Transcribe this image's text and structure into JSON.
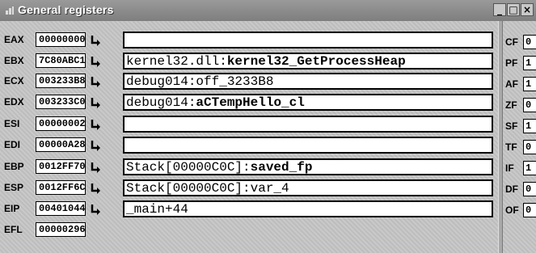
{
  "window": {
    "title": "General registers",
    "minimize_label": "_",
    "maximize_label": "□",
    "close_label": "×"
  },
  "registers": [
    {
      "name": "EAX",
      "value": "00000000",
      "ref": "",
      "ref_bold": ""
    },
    {
      "name": "EBX",
      "value": "7C80ABC1",
      "ref": "kernel32.dll:",
      "ref_bold": "kernel32_GetProcessHeap"
    },
    {
      "name": "ECX",
      "value": "003233B8",
      "ref": "debug014:off_3233B8",
      "ref_bold": ""
    },
    {
      "name": "EDX",
      "value": "003233C0",
      "ref": "debug014:",
      "ref_bold": "aCTempHello_cl"
    },
    {
      "name": "ESI",
      "value": "00000002",
      "ref": "",
      "ref_bold": ""
    },
    {
      "name": "EDI",
      "value": "00000A28",
      "ref": "",
      "ref_bold": ""
    },
    {
      "name": "EBP",
      "value": "0012FF70",
      "ref": "Stack[00000C0C]:",
      "ref_bold": "saved_fp"
    },
    {
      "name": "ESP",
      "value": "0012FF6C",
      "ref": "Stack[00000C0C]:var_4",
      "ref_bold": ""
    },
    {
      "name": "EIP",
      "value": "00401044",
      "ref": "_main+44",
      "ref_bold": ""
    },
    {
      "name": "EFL",
      "value": "00000296",
      "ref": "",
      "ref_bold": ""
    }
  ],
  "flags": [
    {
      "name": "CF",
      "value": "0"
    },
    {
      "name": "PF",
      "value": "1"
    },
    {
      "name": "AF",
      "value": "1"
    },
    {
      "name": "ZF",
      "value": "0"
    },
    {
      "name": "SF",
      "value": "1"
    },
    {
      "name": "TF",
      "value": "0"
    },
    {
      "name": "IF",
      "value": "1"
    },
    {
      "name": "DF",
      "value": "0"
    },
    {
      "name": "OF",
      "value": "0"
    }
  ]
}
